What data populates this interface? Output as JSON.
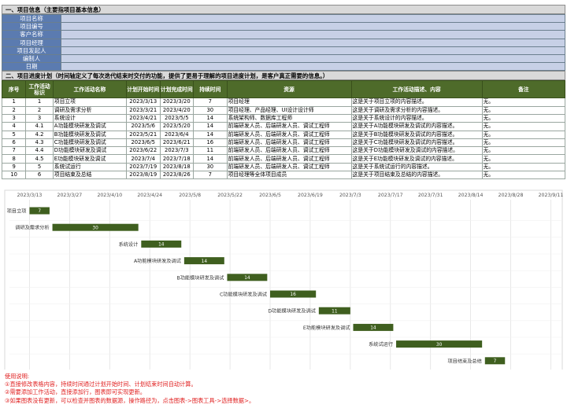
{
  "info": {
    "title": "一、项目信息（主要指项目基本信息）",
    "fields": [
      "项目名称",
      "项目编号",
      "客户名称",
      "项目经理",
      "项目发起人",
      "编制人",
      "日期"
    ]
  },
  "progress": {
    "title": "二、项目进度计划（时间轴定义了每次迭代结束时交付的功能，提供了更易于理解的项目进度计划，是客户真正需要的信息。）",
    "headers": [
      "序号",
      "工作活动标识",
      "工作活动名称",
      "计划开始时间",
      "计划完成时间",
      "持续时间",
      "资源",
      "工作活动描述、内容",
      "备注"
    ],
    "rows": [
      [
        "1",
        "1",
        "项目立项",
        "2023/3/13",
        "2023/3/20",
        "7",
        "项目经理",
        "这是关于项目立项的内容描述。",
        "无。"
      ],
      [
        "2",
        "2",
        "调研及需求分析",
        "2023/3/21",
        "2023/4/20",
        "30",
        "项目经理、产品经理、UI设计设计师",
        "这是关于调研及需求分析的内容描述。",
        "无。"
      ],
      [
        "3",
        "3",
        "系统设计",
        "2023/4/21",
        "2023/5/5",
        "14",
        "系统架构师、数据库工程师",
        "这是关于系统设计的内容描述。",
        "无。"
      ],
      [
        "4",
        "4.1",
        "A功能模块研发及调试",
        "2023/5/6",
        "2023/5/20",
        "14",
        "前端研发人员、后端研发人员、调试工程师",
        "这是关于A功能模块研发及调试的内容描述。",
        "无。"
      ],
      [
        "5",
        "4.2",
        "B功能模块研发及调试",
        "2023/5/21",
        "2023/6/4",
        "14",
        "前端研发人员、后端研发人员、调试工程师",
        "这是关于B功能模块研发及调试的内容描述。",
        "无。"
      ],
      [
        "6",
        "4.3",
        "C功能模块研发及调试",
        "2023/6/5",
        "2023/6/21",
        "16",
        "前端研发人员、后端研发人员、调试工程师",
        "这是关于C功能模块研发及调试的内容描述。",
        "无。"
      ],
      [
        "7",
        "4.4",
        "D功能模块研发及调试",
        "2023/6/22",
        "2023/7/3",
        "11",
        "前端研发人员、后端研发人员、调试工程师",
        "这是关于D功能模块研发及调试的内容描述。",
        "无。"
      ],
      [
        "8",
        "4.5",
        "E功能模块研发及调试",
        "2023/7/4",
        "2023/7/18",
        "14",
        "前端研发人员、后端研发人员、调试工程师",
        "这是关于E功能模块研发及调试的内容描述。",
        "无。"
      ],
      [
        "9",
        "5",
        "系统试运行",
        "2023/7/19",
        "2023/8/18",
        "30",
        "前端研发人员、后端研发人员、调试工程师",
        "这是关于系统试运行的内容描述。",
        "无。"
      ],
      [
        "10",
        "6",
        "项目结束及总结",
        "2023/8/19",
        "2023/8/26",
        "7",
        "项目经理等全体项目成员",
        "这是关于项目结束及总结的内容描述。",
        "无。"
      ]
    ]
  },
  "chart_data": {
    "type": "bar",
    "orientation": "horizontal-gantt",
    "title": "",
    "x_ticks": [
      "2023/3/13",
      "2023/3/27",
      "2023/4/10",
      "2023/4/24",
      "2023/5/8",
      "2023/5/22",
      "2023/6/5",
      "2023/6/19",
      "2023/7/3",
      "2023/7/17",
      "2023/7/31",
      "2023/8/14",
      "2023/8/28",
      "2023/9/11"
    ],
    "xlim": [
      "2023/3/6",
      "2023/9/15"
    ],
    "tasks": [
      {
        "name": "项目立项",
        "start": "2023/3/13",
        "duration": 7
      },
      {
        "name": "调研及需求分析",
        "start": "2023/3/21",
        "duration": 30
      },
      {
        "name": "系统设计",
        "start": "2023/4/21",
        "duration": 14
      },
      {
        "name": "A功能模块研发及调试",
        "start": "2023/5/6",
        "duration": 14
      },
      {
        "name": "B功能模块研发及调试",
        "start": "2023/5/21",
        "duration": 14
      },
      {
        "name": "C功能模块研发及调试",
        "start": "2023/6/5",
        "duration": 16
      },
      {
        "name": "D功能模块研发及调试",
        "start": "2023/6/22",
        "duration": 11
      },
      {
        "name": "E功能模块研发及调试",
        "start": "2023/7/4",
        "duration": 14
      },
      {
        "name": "系统试运行",
        "start": "2023/7/19",
        "duration": 30
      },
      {
        "name": "项目结束及总结",
        "start": "2023/8/19",
        "duration": 7
      }
    ],
    "bar_color": "#3f5f1f",
    "grid": true
  },
  "notes": {
    "heading": "使用说明:",
    "lines": [
      "①直接修改表格内容，持续时间通过计划开始时间、计划结束时间自动计算。",
      "②需要添加工作活动，直接添加行，图表即可实现更新。",
      "③如果图表没有更新，可以检查并图表的数据源，操作路径为，点击图表->图表工具->选择数据>。"
    ]
  }
}
